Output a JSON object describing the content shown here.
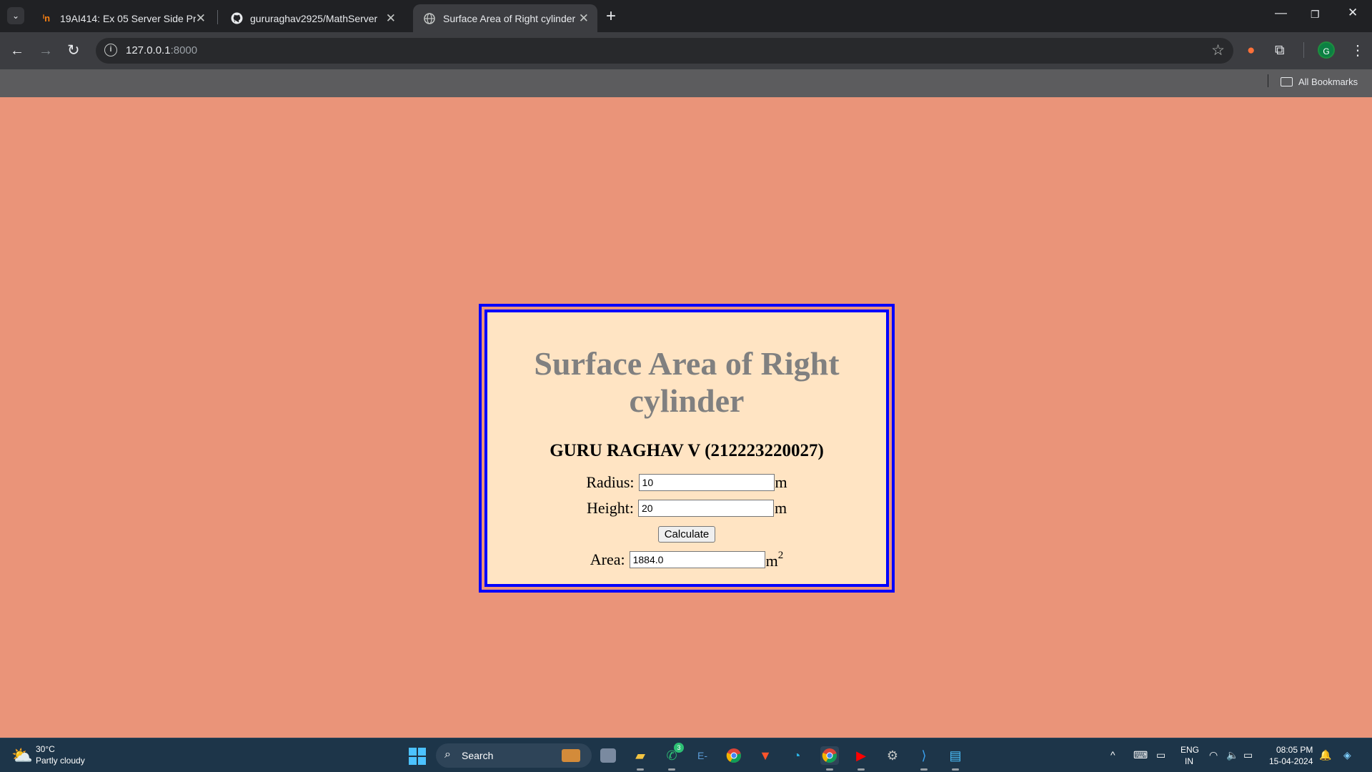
{
  "browser": {
    "tabs": [
      {
        "title": "19AI414: Ex 05 Server Side Proc",
        "icon": "moodle-icon"
      },
      {
        "title": "gururaghav2925/MathServer",
        "icon": "github-icon"
      },
      {
        "title": "Surface Area of Right cylinder",
        "icon": "globe-icon",
        "active": true
      }
    ],
    "address": {
      "host": "127.0.0.1",
      "port": ":8000"
    },
    "profile_initial": "G",
    "bookmarks_label": "All Bookmarks"
  },
  "page": {
    "title": "Surface Area of Right cylinder",
    "subtitle": "GURU RAGHAV V (212223220027)",
    "radius": {
      "label": "Radius:",
      "value": "10",
      "unit": "m"
    },
    "height": {
      "label": "Height:",
      "value": "20",
      "unit": "m"
    },
    "calculate_label": "Calculate",
    "area": {
      "label": "Area:",
      "value": "1884.0",
      "unit": "m",
      "exponent": "2"
    },
    "colors": {
      "background": "#ea9479",
      "card": "#ffe4c3",
      "border": "#0000ff",
      "title": "#808080"
    }
  },
  "taskbar": {
    "weather": {
      "temp": "30°C",
      "desc": "Partly cloudy"
    },
    "search_label": "Search",
    "whatsapp_badge": "3",
    "language": {
      "line1": "ENG",
      "line2": "IN"
    },
    "clock": {
      "time": "08:05 PM",
      "date": "15-04-2024"
    }
  }
}
